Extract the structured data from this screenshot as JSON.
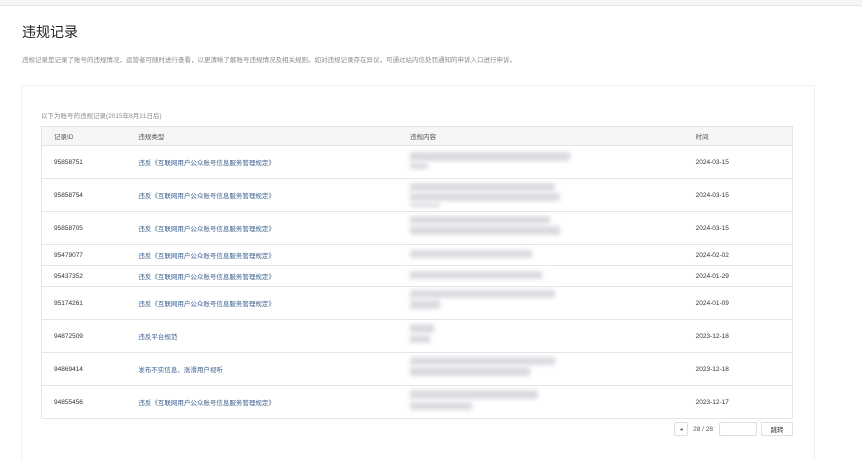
{
  "page": {
    "title": "违规记录",
    "description": "违规记录是记录了账号的违规情况，运营者可随时进行查看，以更清晰了解账号违规情况及相关规则。如对违规记录存在异议，可通过站内信处罚通知的申诉入口进行申诉。"
  },
  "records": {
    "note": "以下为账号的违规记录(2015年8月21日后)",
    "columns": [
      "记录ID",
      "违规类型",
      "违规内容",
      "时间"
    ],
    "rows": [
      {
        "id": "95858751",
        "type": "违反《互联网用户公众账号信息服务管理规定》",
        "time": "2024-03-15"
      },
      {
        "id": "95858754",
        "type": "违反《互联网用户公众账号信息服务管理规定》",
        "time": "2024-03-15"
      },
      {
        "id": "95858705",
        "type": "违反《互联网用户公众账号信息服务管理规定》",
        "time": "2024-03-15"
      },
      {
        "id": "95479077",
        "type": "违反《互联网用户公众账号信息服务管理规定》",
        "time": "2024-02-02"
      },
      {
        "id": "95437352",
        "type": "违反《互联网用户公众账号信息服务管理规定》",
        "time": "2024-01-29"
      },
      {
        "id": "95174261",
        "type": "违反《互联网用户公众账号信息服务管理规定》",
        "time": "2024-01-09"
      },
      {
        "id": "94872509",
        "type": "违反平台规范",
        "time": "2023-12-18"
      },
      {
        "id": "94869414",
        "type": "发布不实信息、涨滑用户视听",
        "time": "2023-12-18"
      },
      {
        "id": "94855456",
        "type": "违反《互联网用户公众账号信息服务管理规定》",
        "time": "2023-12-17"
      }
    ]
  },
  "pagination": {
    "prev_icon": "chevron-left-icon",
    "current": "28 / 28",
    "jump_input_value": "",
    "jump_label": "跳转"
  },
  "colors": {
    "link": "#3a5f8c",
    "header_bg": "#f5f6f7",
    "page_bg": "#f3f4f6"
  }
}
